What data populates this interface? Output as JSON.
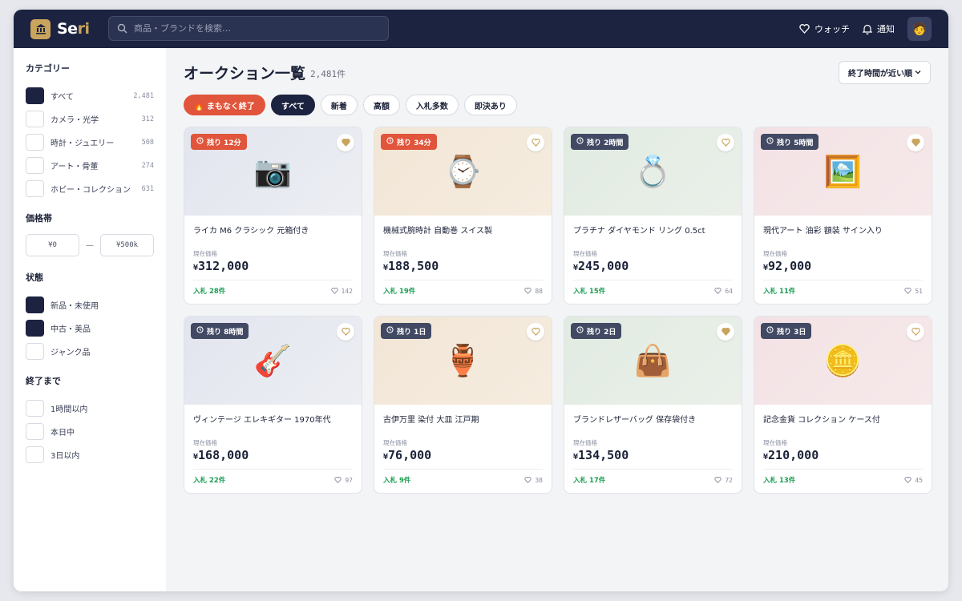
{
  "colors": {
    "navy": "#1c2340",
    "gold": "#c9a45c",
    "urgent": "#e0553b",
    "bid_green": "#1f9e55"
  },
  "header": {
    "logo_icon": "bank-icon",
    "logo_part1": "Se",
    "logo_part2": "ri",
    "search_placeholder": "商品・ブランドを検索…",
    "watch_label": "ウォッチ",
    "notify_label": "通知",
    "avatar": "🧑"
  },
  "sidebar": {
    "category_title": "カテゴリー",
    "categories": [
      {
        "label": "すべて",
        "count": "2,481",
        "checked": true
      },
      {
        "label": "カメラ・光学",
        "count": "312",
        "checked": false
      },
      {
        "label": "時計・ジュエリー",
        "count": "508",
        "checked": false
      },
      {
        "label": "アート・骨董",
        "count": "274",
        "checked": false
      },
      {
        "label": "ホビー・コレクション",
        "count": "631",
        "checked": false
      }
    ],
    "price_title": "価格帯",
    "price_min": "¥0",
    "price_sep": "—",
    "price_max": "¥500k",
    "condition_title": "状態",
    "conditions": [
      {
        "label": "新品・未使用",
        "checked": true
      },
      {
        "label": "中古・美品",
        "checked": true
      },
      {
        "label": "ジャンク品",
        "checked": false
      }
    ],
    "ending_title": "終了まで",
    "endings": [
      {
        "label": "1時間以内",
        "checked": false
      },
      {
        "label": "本日中",
        "checked": false
      },
      {
        "label": "3日以内",
        "checked": false
      }
    ]
  },
  "main": {
    "title": "オークション一覧",
    "count": "2,481件",
    "sort_label": "終了時間が近い順",
    "chips": [
      {
        "label": "🔥 まもなく終了",
        "style": "urgent"
      },
      {
        "label": "すべて",
        "style": "active"
      },
      {
        "label": "新着",
        "style": "normal"
      },
      {
        "label": "高額",
        "style": "normal"
      },
      {
        "label": "入札多数",
        "style": "normal"
      },
      {
        "label": "即決あり",
        "style": "normal"
      }
    ],
    "price_label": "現在価格",
    "currency": "¥",
    "items": [
      {
        "time": "残り 12分",
        "urgent": true,
        "emoji": "📷",
        "bg": 0,
        "fav": true,
        "name": "ライカ M6 クラシック 元箱付き",
        "price": "312,000",
        "bids": "入札 28件",
        "watchers": "142"
      },
      {
        "time": "残り 34分",
        "urgent": true,
        "emoji": "⌚",
        "bg": 1,
        "fav": false,
        "name": "機械式腕時計 自動巻 スイス製",
        "price": "188,500",
        "bids": "入札 19件",
        "watchers": "88"
      },
      {
        "time": "残り 2時間",
        "urgent": false,
        "emoji": "💍",
        "bg": 2,
        "fav": false,
        "name": "プラチナ ダイヤモンド リング 0.5ct",
        "price": "245,000",
        "bids": "入札 15件",
        "watchers": "64"
      },
      {
        "time": "残り 5時間",
        "urgent": false,
        "emoji": "🖼️",
        "bg": 3,
        "fav": true,
        "name": "現代アート 油彩 額装 サイン入り",
        "price": "92,000",
        "bids": "入札 11件",
        "watchers": "51"
      },
      {
        "time": "残り 8時間",
        "urgent": false,
        "emoji": "🎸",
        "bg": 0,
        "fav": false,
        "name": "ヴィンテージ エレキギター 1970年代",
        "price": "168,000",
        "bids": "入札 22件",
        "watchers": "97"
      },
      {
        "time": "残り 1日",
        "urgent": false,
        "emoji": "🏺",
        "bg": 1,
        "fav": false,
        "name": "古伊万里 染付 大皿 江戸期",
        "price": "76,000",
        "bids": "入札 9件",
        "watchers": "38"
      },
      {
        "time": "残り 2日",
        "urgent": false,
        "emoji": "👜",
        "bg": 2,
        "fav": true,
        "name": "ブランドレザーバッグ 保存袋付き",
        "price": "134,500",
        "bids": "入札 17件",
        "watchers": "72"
      },
      {
        "time": "残り 3日",
        "urgent": false,
        "emoji": "🪙",
        "bg": 3,
        "fav": false,
        "name": "記念金貨 コレクション ケース付",
        "price": "210,000",
        "bids": "入札 13件",
        "watchers": "45"
      }
    ]
  }
}
